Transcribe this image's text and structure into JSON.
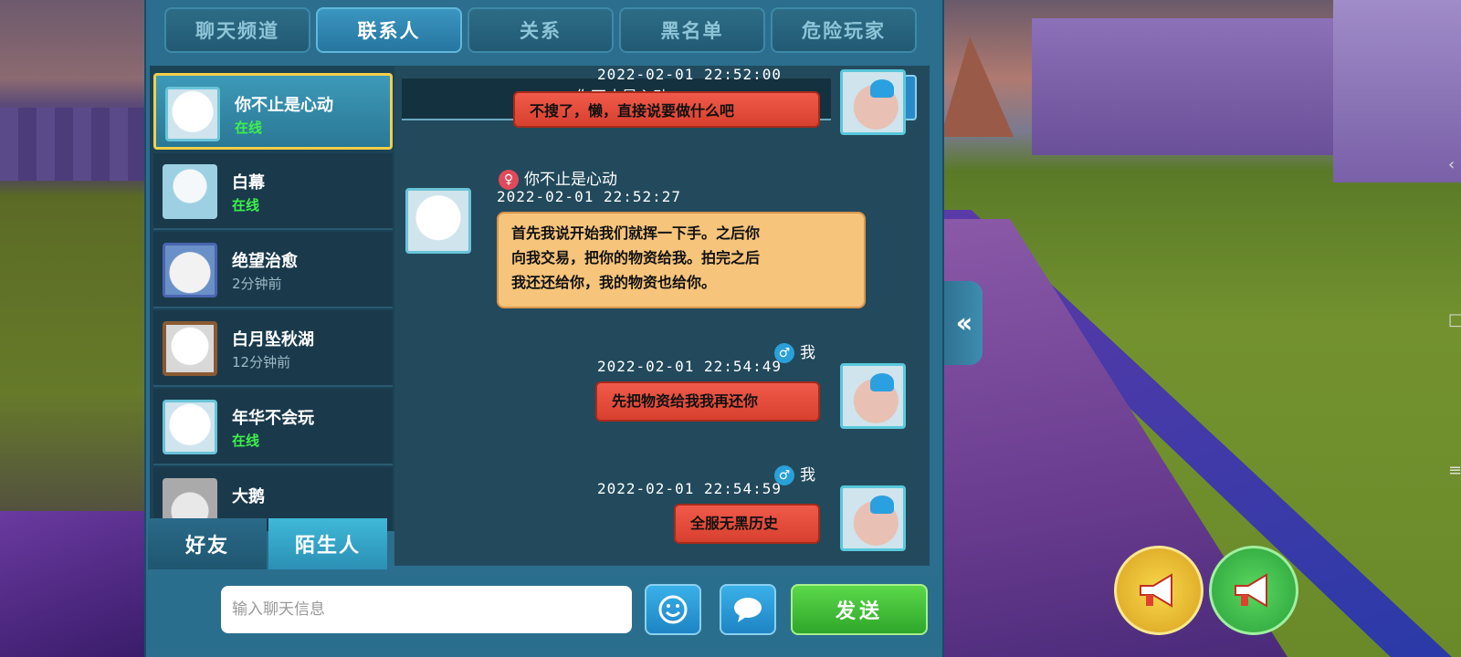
{
  "tabs": [
    "聊天频道",
    "联系人",
    "关系",
    "黑名单",
    "危险玩家"
  ],
  "contacts": [
    {
      "name": "你不止是心动",
      "status": "在线",
      "online": true
    },
    {
      "name": "白幕",
      "status": "在线",
      "online": true
    },
    {
      "name": "绝望治愈",
      "status": "2分钟前",
      "online": false
    },
    {
      "name": "白月坠秋湖",
      "status": "12分钟前",
      "online": false
    },
    {
      "name": "年华不会玩",
      "status": "在线",
      "online": true
    },
    {
      "name": "大鹅",
      "status": "",
      "online": false
    }
  ],
  "filters": {
    "friends": "好友",
    "strangers": "陌生人"
  },
  "pinned": {
    "sender": "你不止是心动"
  },
  "messages": [
    {
      "time": "2022-02-01  22:52:00",
      "text": "不搜了，懒，直接说要做什么吧",
      "mine": true
    },
    {
      "sender": "你不止是心动",
      "time": "2022-02-01  22:52:27",
      "lines": [
        "首先我说开始我们就挥一下手。之后你",
        "向我交易，把你的物资给我。拍完之后",
        "我还还给你，我的物资也给你。"
      ],
      "mine": false
    },
    {
      "sender": "我",
      "time": "2022-02-01  22:54:49",
      "text": "先把物资给我我再还你",
      "mine": true
    },
    {
      "sender": "我",
      "time": "2022-02-01  22:54:59",
      "text": "全服无黑历史",
      "mine": true
    }
  ],
  "input": {
    "placeholder": "输入聊天信息"
  },
  "send_label": "发送",
  "icons": {
    "back": "double-chevron-left-icon",
    "emoji": "smiley-icon",
    "bubble": "speech-bubble-icon"
  }
}
